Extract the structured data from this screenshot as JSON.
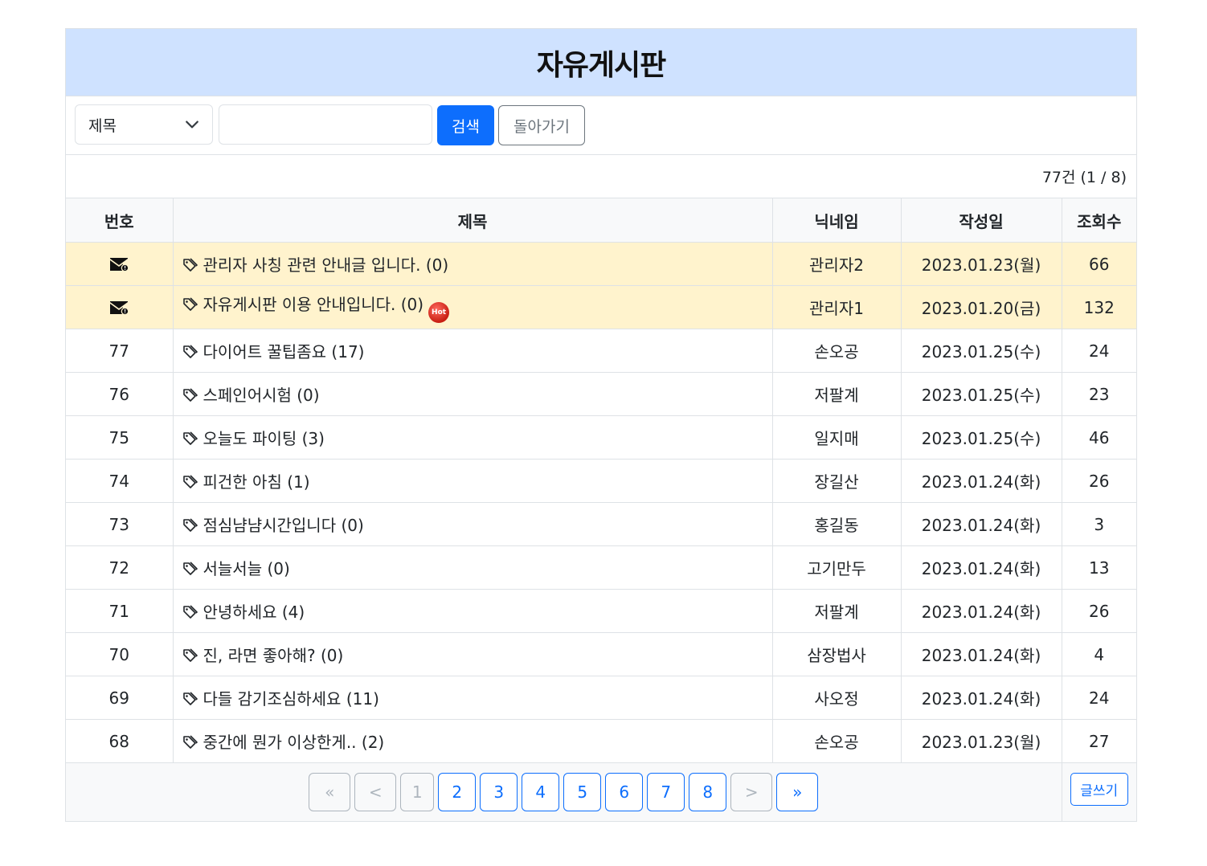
{
  "header": {
    "title": "자유게시판"
  },
  "search": {
    "field_selected": "제목",
    "query_value": "",
    "search_label": "검색",
    "back_label": "돌아가기"
  },
  "summary": {
    "count_text": "77건 (1 / 8)"
  },
  "table": {
    "columns": [
      "번호",
      "제목",
      "닉네임",
      "작성일",
      "조회수"
    ],
    "notices": [
      {
        "icon": "envelope-icon",
        "title": "관리자 사칭 관련 안내글 입니다. (0)",
        "nickname": "관리자2",
        "date": "2023.01.23(월)",
        "views": "66",
        "hot": false
      },
      {
        "icon": "envelope-icon",
        "title": "자유게시판 이용 안내입니다. (0)",
        "nickname": "관리자1",
        "date": "2023.01.20(금)",
        "views": "132",
        "hot": true,
        "hot_label": "Hot"
      }
    ],
    "rows": [
      {
        "no": "77",
        "title": "다이어트 꿀팁좀요 (17)",
        "nickname": "손오공",
        "date": "2023.01.25(수)",
        "views": "24"
      },
      {
        "no": "76",
        "title": "스페인어시험 (0)",
        "nickname": "저팔계",
        "date": "2023.01.25(수)",
        "views": "23"
      },
      {
        "no": "75",
        "title": "오늘도 파이팅 (3)",
        "nickname": "일지매",
        "date": "2023.01.25(수)",
        "views": "46"
      },
      {
        "no": "74",
        "title": "피건한 아침 (1)",
        "nickname": "장길산",
        "date": "2023.01.24(화)",
        "views": "26"
      },
      {
        "no": "73",
        "title": "점심냠냠시간입니다 (0)",
        "nickname": "홍길동",
        "date": "2023.01.24(화)",
        "views": "3"
      },
      {
        "no": "72",
        "title": "서늘서늘 (0)",
        "nickname": "고기만두",
        "date": "2023.01.24(화)",
        "views": "13"
      },
      {
        "no": "71",
        "title": "안녕하세요 (4)",
        "nickname": "저팔계",
        "date": "2023.01.24(화)",
        "views": "26"
      },
      {
        "no": "70",
        "title": "진, 라면 좋아해? (0)",
        "nickname": "삼장법사",
        "date": "2023.01.24(화)",
        "views": "4"
      },
      {
        "no": "69",
        "title": "다들 감기조심하세요 (11)",
        "nickname": "사오정",
        "date": "2023.01.24(화)",
        "views": "24"
      },
      {
        "no": "68",
        "title": "중간에 뭔가 이상한게.. (2)",
        "nickname": "손오공",
        "date": "2023.01.23(월)",
        "views": "27"
      }
    ]
  },
  "pagination": {
    "first": "«",
    "prev": "<",
    "pages": [
      "1",
      "2",
      "3",
      "4",
      "5",
      "6",
      "7",
      "8"
    ],
    "current": "1",
    "next": ">",
    "last": "»"
  },
  "write_label": "글쓰기",
  "colors": {
    "header_bg": "#cfe2ff",
    "notice_bg": "#fff3cd",
    "primary": "#0d6efd"
  }
}
